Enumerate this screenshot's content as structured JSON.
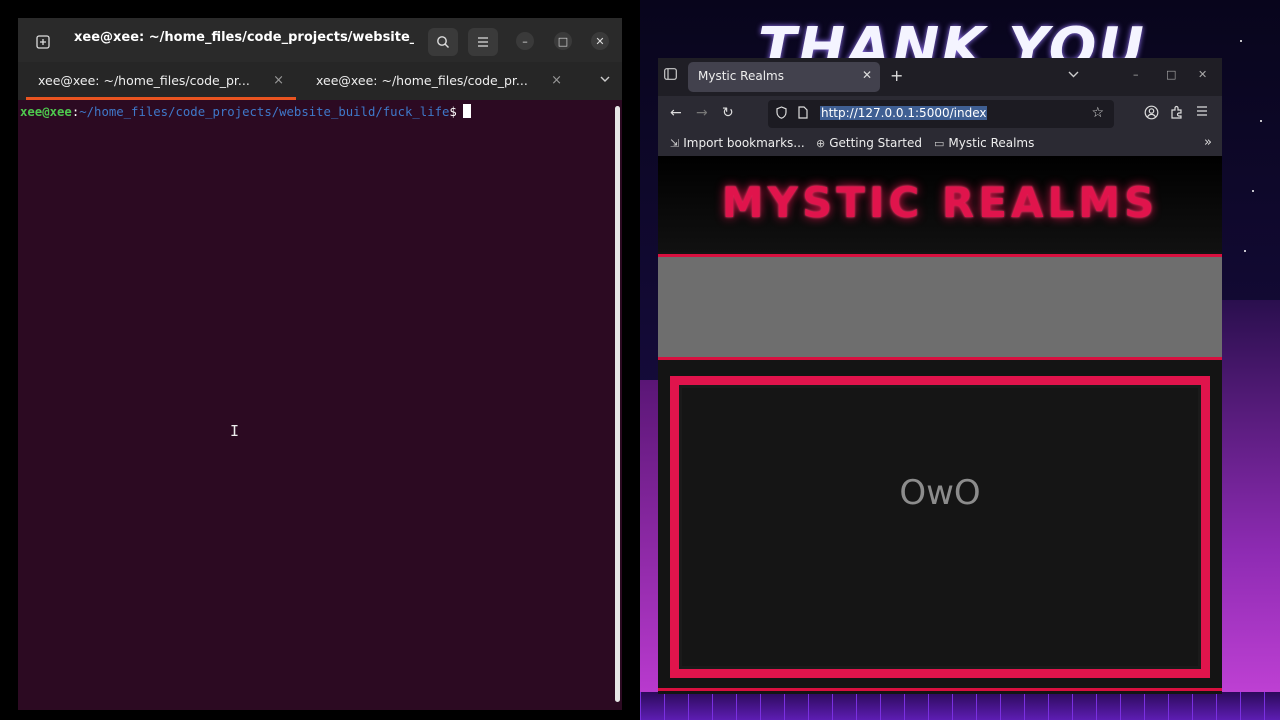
{
  "wallpaper": {
    "text": "THANK YOU"
  },
  "terminal": {
    "title": "xee@xee: ~/home_files/code_projects/website_...",
    "tabs": [
      {
        "label": "xee@xee: ~/home_files/code_pr...",
        "close": "×",
        "active": true
      },
      {
        "label": "xee@xee: ~/home_files/code_pr...",
        "close": "×",
        "active": false
      }
    ],
    "prompt": {
      "user": "xee@xee",
      "colon": ":",
      "path": "~/home_files/code_projects/website_build/fuck_life",
      "dollar": "$"
    },
    "pointer": "I"
  },
  "browser": {
    "tab_title": "Mystic Realms",
    "url": "http://127.0.0.1:5000/index",
    "bookmarks": [
      {
        "label": "Import bookmarks...",
        "icon": "import-icon"
      },
      {
        "label": "Getting Started",
        "icon": "globe-icon"
      },
      {
        "label": "Mystic Realms",
        "icon": "page-icon"
      }
    ],
    "page": {
      "title": "MYSTIC REALMS",
      "panel_text": "OwO",
      "accent": "#e0144c"
    }
  }
}
